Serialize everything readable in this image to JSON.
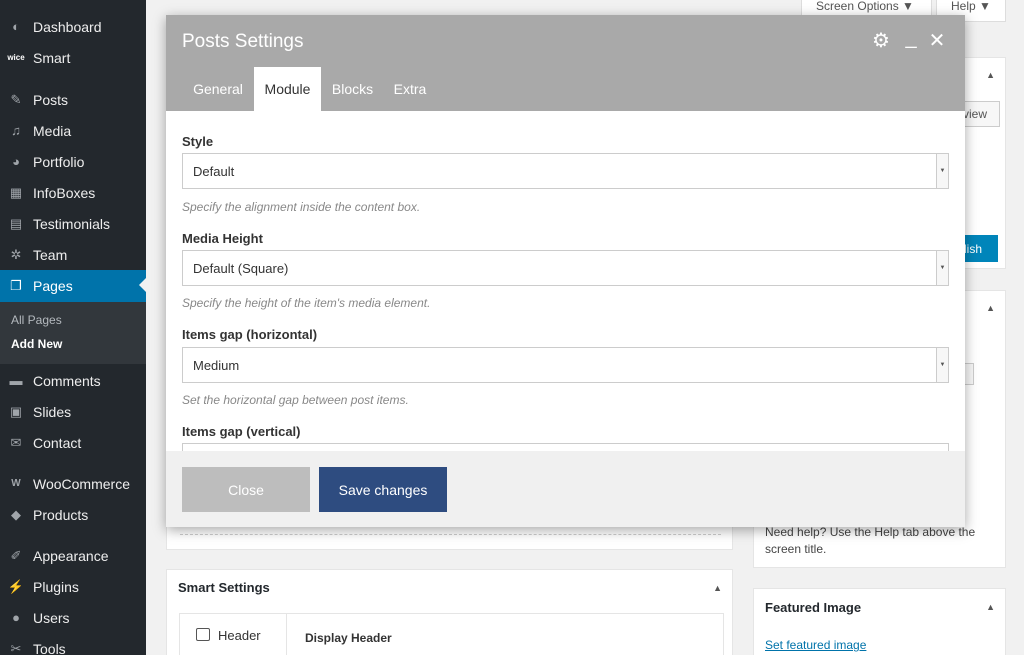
{
  "sidebar": {
    "items": [
      {
        "label": "Dashboard",
        "icon": "dashboard-icon",
        "glyph": "◐"
      },
      {
        "label": "Smart",
        "icon": "smart-logo-icon",
        "glyph": "wice"
      },
      {
        "label": "Posts",
        "icon": "pin-icon",
        "glyph": "✎"
      },
      {
        "label": "Media",
        "icon": "media-icon",
        "glyph": "♫"
      },
      {
        "label": "Portfolio",
        "icon": "portfolio-icon",
        "glyph": "◕"
      },
      {
        "label": "InfoBoxes",
        "icon": "grid-icon",
        "glyph": "▦"
      },
      {
        "label": "Testimonials",
        "icon": "testimonials-icon",
        "glyph": "▤"
      },
      {
        "label": "Team",
        "icon": "team-icon",
        "glyph": "✲"
      },
      {
        "label": "Pages",
        "icon": "pages-icon",
        "glyph": "❐"
      },
      {
        "label": "Comments",
        "icon": "comments-icon",
        "glyph": "▬"
      },
      {
        "label": "Slides",
        "icon": "slides-icon",
        "glyph": "▣"
      },
      {
        "label": "Contact",
        "icon": "mail-icon",
        "glyph": "✉"
      },
      {
        "label": "WooCommerce",
        "icon": "woocommerce-icon",
        "glyph": "W"
      },
      {
        "label": "Products",
        "icon": "products-icon",
        "glyph": "◆"
      },
      {
        "label": "Appearance",
        "icon": "appearance-icon",
        "glyph": "✐"
      },
      {
        "label": "Plugins",
        "icon": "plugins-icon",
        "glyph": "⚡"
      },
      {
        "label": "Users",
        "icon": "users-icon",
        "glyph": "●"
      },
      {
        "label": "Tools",
        "icon": "tools-icon",
        "glyph": "✂"
      }
    ],
    "submenu": [
      "All Pages",
      "Add New"
    ]
  },
  "topbar": {
    "screen_options": "Screen Options ▼",
    "help": "Help ▼"
  },
  "side_boxes": {
    "preview_label": "view",
    "publish_label": "lish",
    "help_text": "Need help? Use the Help tab above the screen title.",
    "featured_image_title": "Featured Image",
    "set_featured_image": "Set featured image"
  },
  "smart_settings": {
    "title": "Smart Settings",
    "header_item": "Header",
    "display_header": "Display Header"
  },
  "modal": {
    "title": "Posts Settings",
    "tabs": [
      "General",
      "Module",
      "Blocks",
      "Extra"
    ],
    "active_tab": "Module",
    "fields": [
      {
        "label": "Style",
        "value": "Default",
        "help": "Specify the alignment inside the content box."
      },
      {
        "label": "Media Height",
        "value": "Default (Square)",
        "help": "Specify the height of the item's media element."
      },
      {
        "label": "Items gap (horizontal)",
        "value": "Medium",
        "help": "Set the horizontal gap between post items."
      },
      {
        "label": "Items gap (vertical)",
        "value": "",
        "help": ""
      }
    ],
    "close_label": "Close",
    "save_label": "Save changes"
  },
  "colors": {
    "accent": "#0073aa",
    "sidebar": "#23282d",
    "save_button": "#2e4c80",
    "modal_header": "#a9a9a9"
  }
}
